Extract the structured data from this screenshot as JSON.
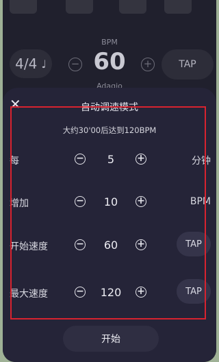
{
  "header": {
    "bpm_caption": "BPM",
    "bpm_value": "60",
    "tempo_name": "Adagio",
    "time_signature": "4/4",
    "note_glyph": "♩",
    "tap_label": "TAP",
    "minus_glyph": "−",
    "plus_glyph": "+"
  },
  "sheet": {
    "close_glyph": "✕",
    "title": "自动调速模式",
    "subtitle": "大约30'00后达到120BPM",
    "minus_glyph": "−",
    "plus_glyph": "+",
    "rows": [
      {
        "label": "每",
        "value": "5",
        "unit": "分钟"
      },
      {
        "label": "增加",
        "value": "10",
        "unit": "BPM"
      },
      {
        "label": "开始速度",
        "value": "60",
        "tap": "TAP"
      },
      {
        "label": "最大速度",
        "value": "120",
        "tap": "TAP"
      }
    ],
    "start_label": "开始"
  },
  "colors": {
    "background": "#20202d",
    "sheet": "#252438",
    "highlight": "#d8232f"
  }
}
